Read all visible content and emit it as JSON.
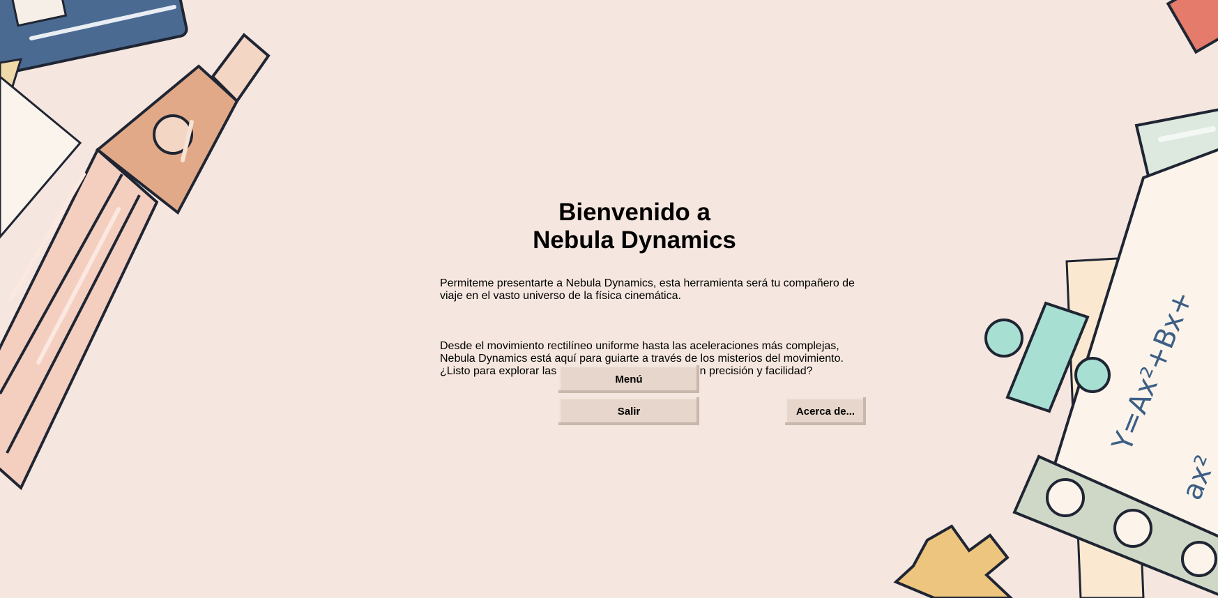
{
  "welcome": {
    "title_line1": "Bienvenido a",
    "title_line2": "Nebula Dynamics",
    "paragraph1": "Permiteme presentarte a Nebula Dynamics, esta herramienta será tu compañero de\nviaje en el vasto universo de la física cinemática.",
    "paragraph2": "Desde el movimiento rectilíneo uniforme hasta las aceleraciones más complejas,\nNebula Dynamics está aquí para guiarte a través de los misterios del movimiento.\n¿Listo para explorar las estrellas de la cinemática con precisión y facilidad?"
  },
  "buttons": {
    "menu": "Menú",
    "exit": "Salir",
    "about": "Acerca de..."
  },
  "decor": {
    "formula": "Y=Ax²+Bx+",
    "formula_partial": "ax²"
  },
  "colors": {
    "background": "#f5e7df",
    "button": "#e7d6cb"
  }
}
